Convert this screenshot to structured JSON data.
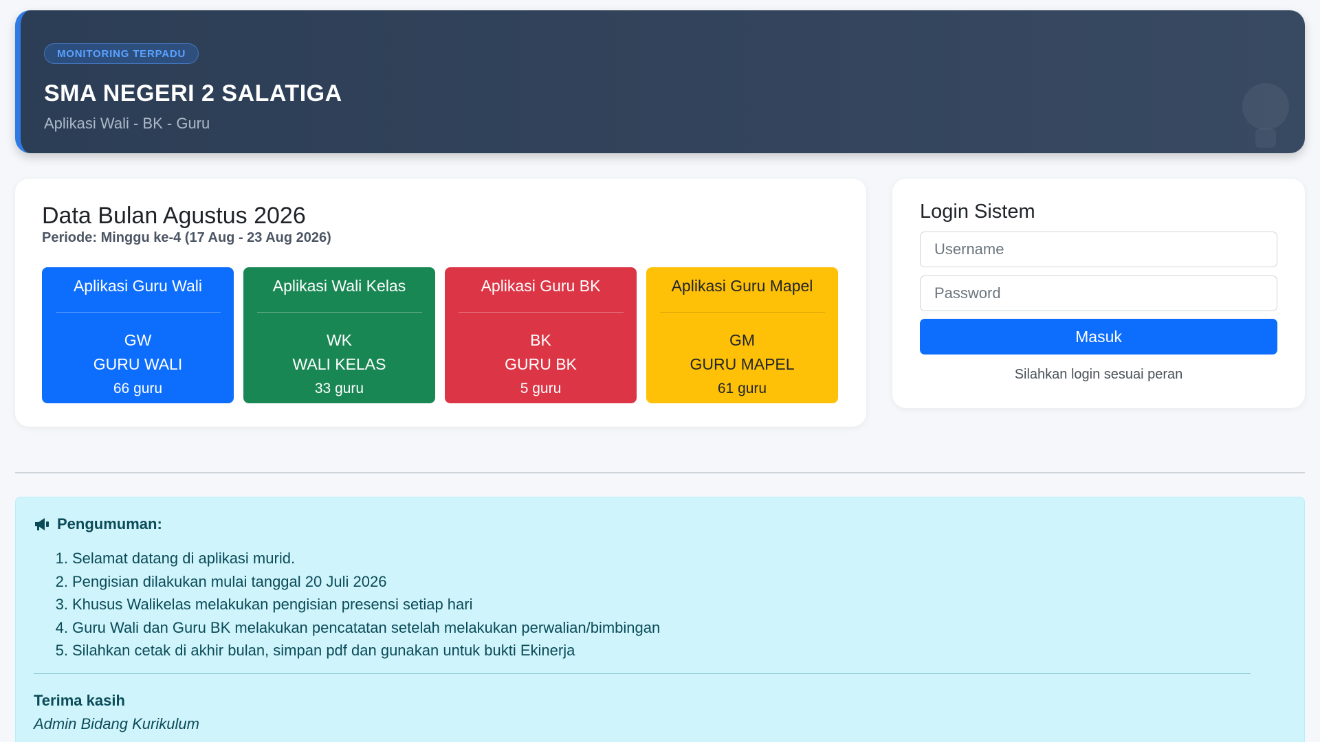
{
  "header": {
    "badge": "MONITORING TERPADU",
    "title": "SMA NEGERI 2 SALATIGA",
    "subtitle": "Aplikasi Wali - BK - Guru"
  },
  "data_card": {
    "title": "Data Bulan Agustus 2026",
    "period": "Periode: Minggu ke-4 (17 Aug - 23 Aug 2026)",
    "apps": [
      {
        "label": "Aplikasi Guru Wali",
        "code": "GW",
        "name": "GURU WALI",
        "count": "66 guru",
        "color": "#0d6efd"
      },
      {
        "label": "Aplikasi Wali Kelas",
        "code": "WK",
        "name": "WALI KELAS",
        "count": "33 guru",
        "color": "#198754"
      },
      {
        "label": "Aplikasi Guru BK",
        "code": "BK",
        "name": "GURU BK",
        "count": "5 guru",
        "color": "#dc3545"
      },
      {
        "label": "Aplikasi Guru Mapel",
        "code": "GM",
        "name": "GURU MAPEL",
        "count": "61 guru",
        "color": "#ffc107"
      }
    ]
  },
  "login": {
    "title": "Login Sistem",
    "username_placeholder": "Username",
    "password_placeholder": "Password",
    "submit_label": "Masuk",
    "hint": "Silahkan login sesuai peran"
  },
  "announcement": {
    "icon": "megaphone-icon",
    "heading": "Pengumuman:",
    "items": [
      {
        "num": "1.",
        "text": "Selamat datang di aplikasi murid."
      },
      {
        "num": "2.",
        "text": "Pengisian dilakukan mulai tanggal 20 Juli 2026"
      },
      {
        "num": "3.",
        "text": "Khusus Walikelas melakukan pengisian presensi setiap hari"
      },
      {
        "num": "4.",
        "text": "Guru Wali dan Guru BK melakukan pencatatan setelah melakukan perwalian/bimbingan"
      },
      {
        "num": "5.",
        "text": "Silahkan cetak di akhir bulan, simpan pdf dan gunakan untuk bukti Ekinerja"
      }
    ],
    "thanks": "Terima kasih",
    "signature": "Admin Bidang Kurikulum"
  }
}
